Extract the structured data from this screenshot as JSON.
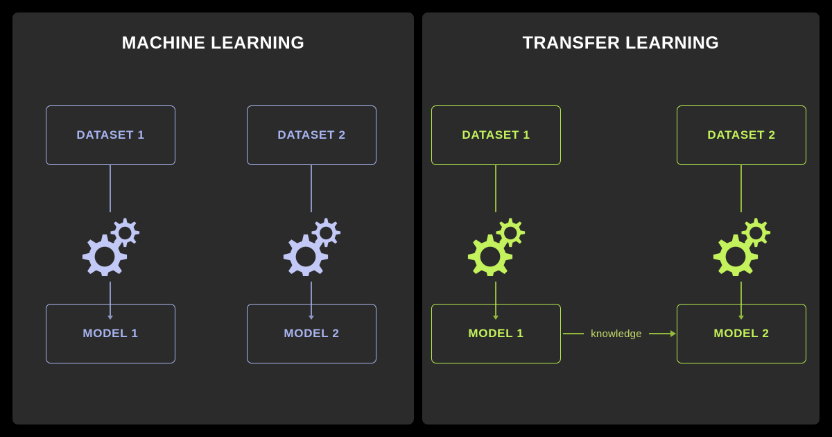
{
  "background_color": "#000000",
  "panel_color": "#2b2b2b",
  "panels": [
    {
      "id": "machine-learning",
      "title": "MACHINE LEARNING",
      "accent_color": "#a8b4f0",
      "border_color": "#aab6ee",
      "line_color": "#8f98c4",
      "branches": [
        {
          "dataset": "DATASET 1",
          "gear_icon": "gears-icon",
          "model": "MODEL 1"
        },
        {
          "dataset": "DATASET 2",
          "gear_icon": "gears-icon",
          "model": "MODEL 2"
        }
      ]
    },
    {
      "id": "transfer-learning",
      "title": "TRANSFER LEARNING",
      "accent_color": "#c3f25c",
      "border_color": "#b6ec4e",
      "line_color": "#93ba3c",
      "branches": [
        {
          "dataset": "DATASET 1",
          "gear_icon": "gears-icon",
          "model": "MODEL 1"
        },
        {
          "dataset": "DATASET 2",
          "gear_icon": "gears-icon",
          "model": "MODEL 2"
        }
      ],
      "transfer": {
        "label": "knowledge",
        "from": "MODEL 1",
        "to": "MODEL 2",
        "color": "#c3d96a"
      }
    }
  ]
}
